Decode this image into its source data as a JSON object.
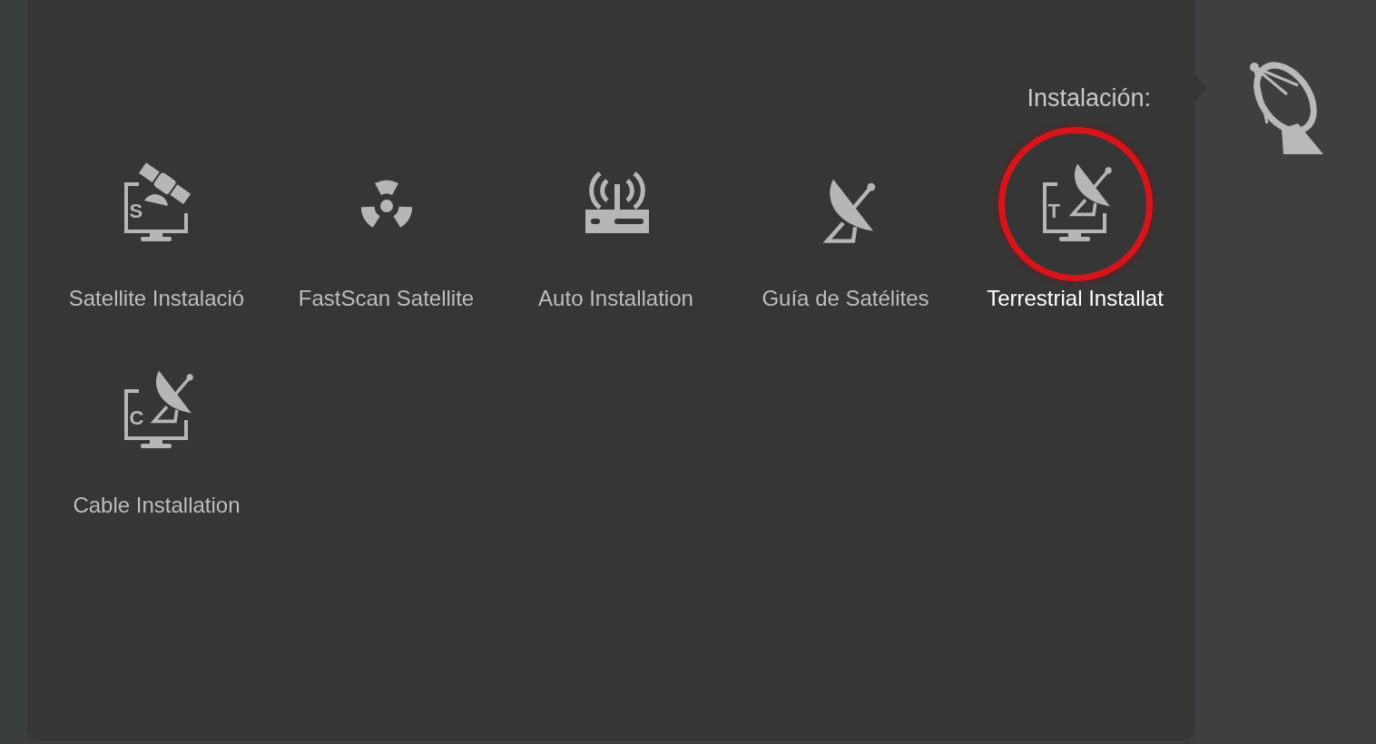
{
  "menu": {
    "title": "Instalación:",
    "items": [
      {
        "kind": "satellite-monitor",
        "letter": "S",
        "label": "Satellite Instalació",
        "selected": false
      },
      {
        "kind": "fastscan",
        "label": "FastScan Satellite",
        "selected": false
      },
      {
        "kind": "router",
        "label": "Auto Installation",
        "selected": false
      },
      {
        "kind": "dish",
        "label": "Guía de Satélites",
        "selected": false
      },
      {
        "kind": "dish-monitor",
        "letter": "T",
        "label": "Terrestrial Installat",
        "selected": true
      },
      {
        "kind": "dish-monitor",
        "letter": "C",
        "label": "Cable Installation",
        "selected": false
      }
    ]
  }
}
